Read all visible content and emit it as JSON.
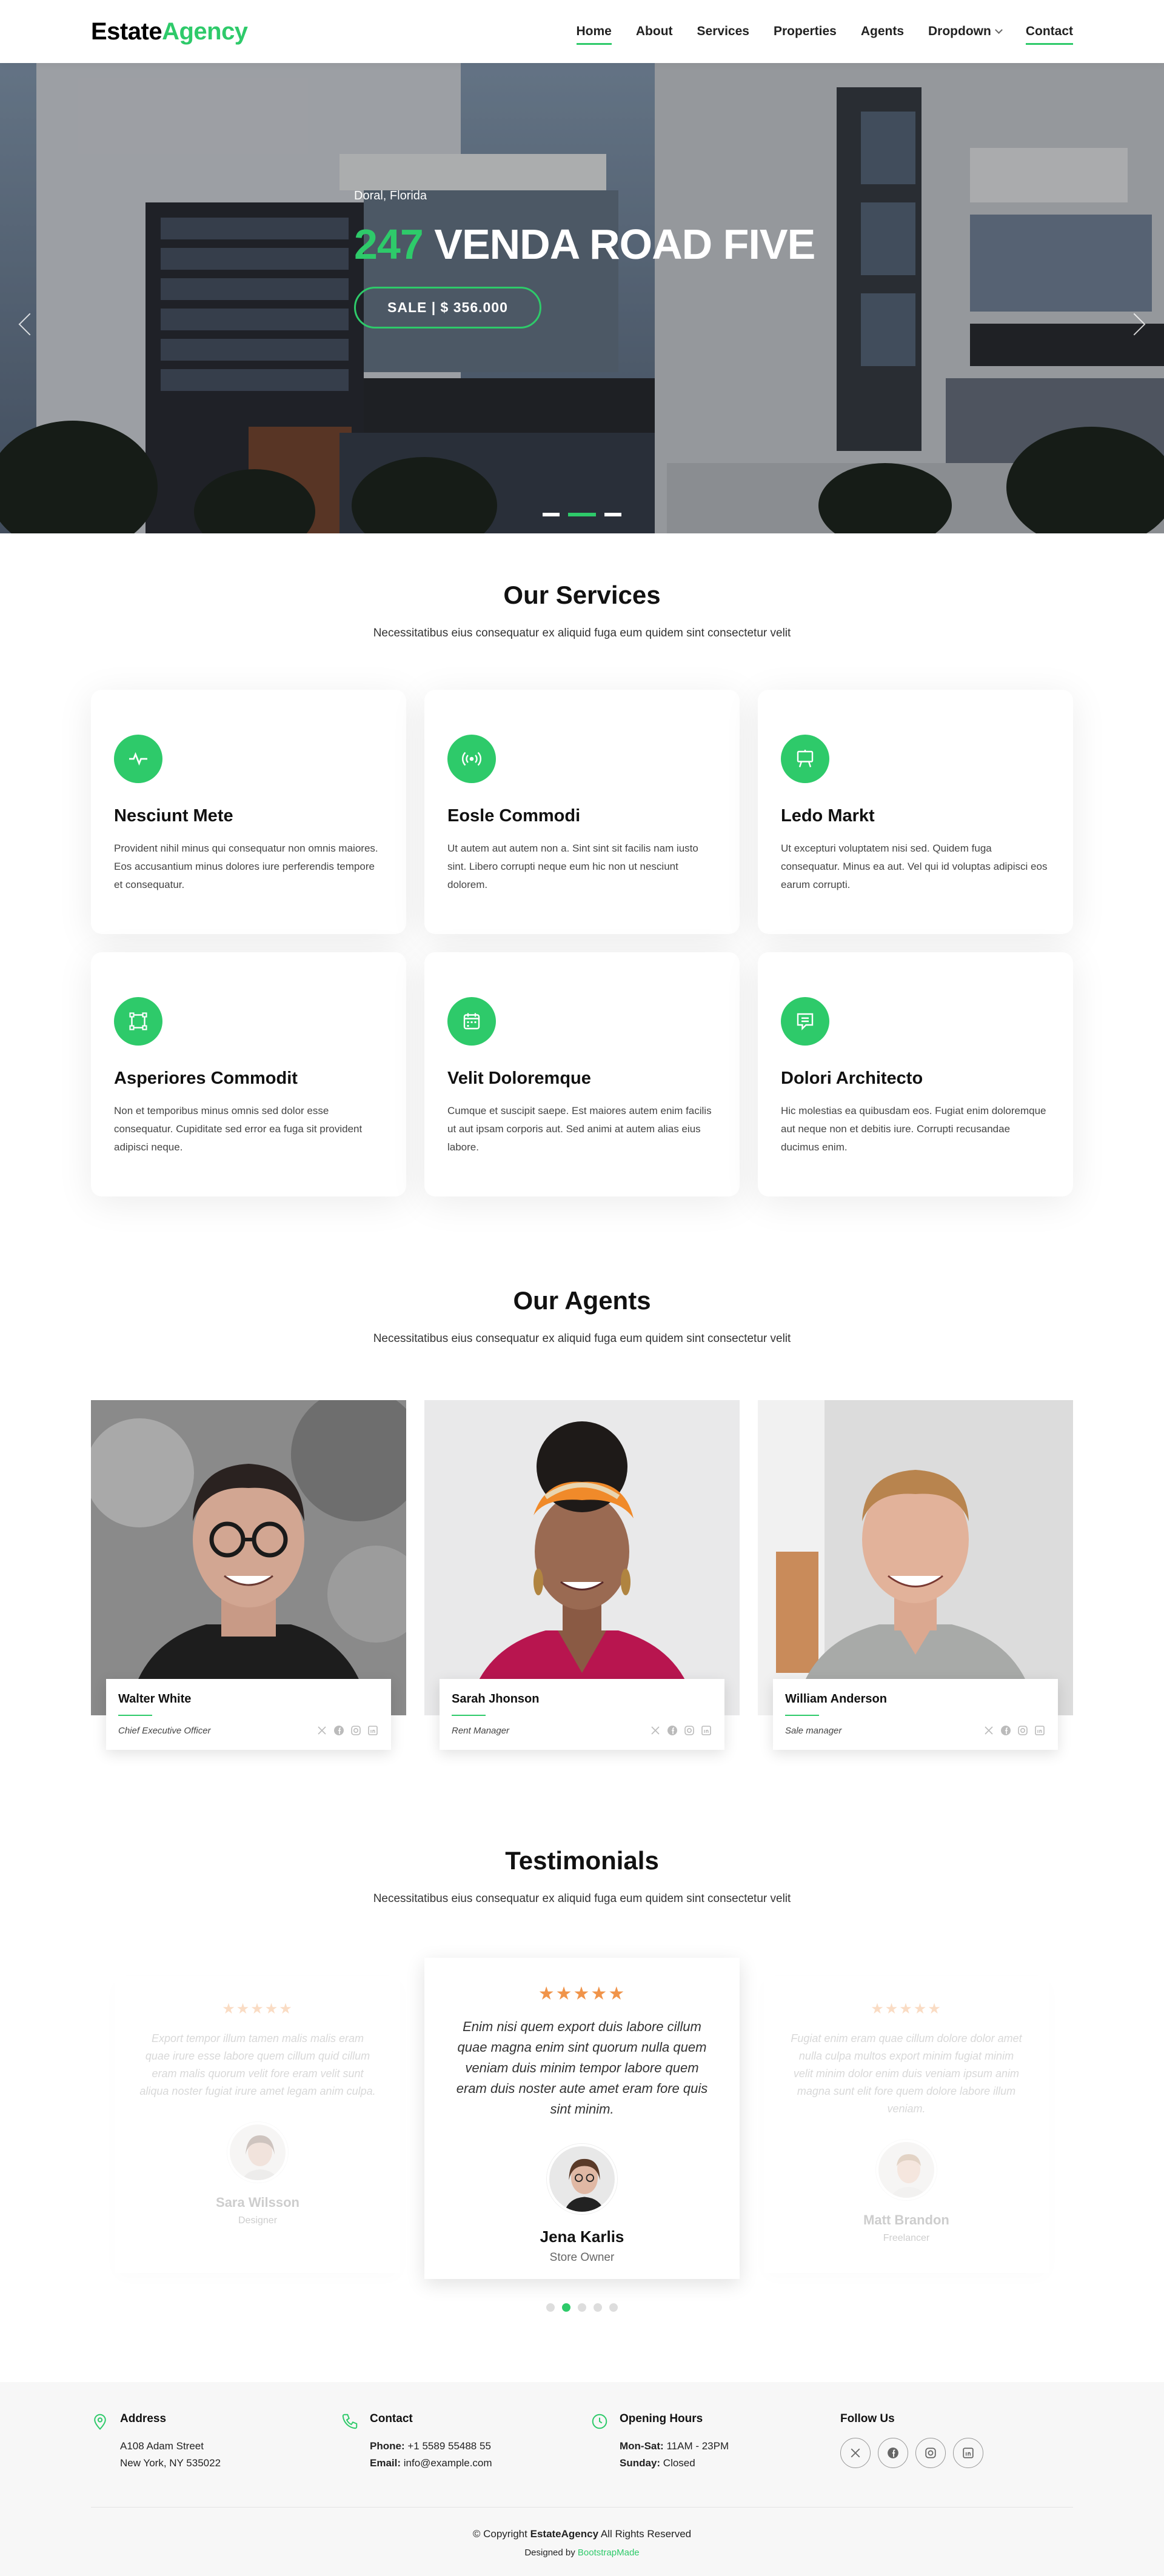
{
  "header": {
    "logo_main": "Estate",
    "logo_accent": "Agency",
    "nav": [
      "Home",
      "About",
      "Services",
      "Properties",
      "Agents",
      "Dropdown",
      "Contact"
    ]
  },
  "hero": {
    "city": "Doral, Florida",
    "number": "247",
    "street": "VENDA ROAD FIVE",
    "button": "SALE | $ 356.000"
  },
  "services": {
    "title": "Our Services",
    "subtitle": "Necessitatibus eius consequatur ex aliquid fuga eum quidem sint consectetur velit",
    "items": [
      {
        "title": "Nesciunt Mete",
        "text": "Provident nihil minus qui consequatur non omnis maiores. Eos accusantium minus dolores iure perferendis tempore et consequatur.",
        "icon": "activity-icon"
      },
      {
        "title": "Eosle Commodi",
        "text": "Ut autem aut autem non a. Sint sint sit facilis nam iusto sint. Libero corrupti neque eum hic non ut nesciunt dolorem.",
        "icon": "broadcast-icon"
      },
      {
        "title": "Ledo Markt",
        "text": "Ut excepturi voluptatem nisi sed. Quidem fuga consequatur. Minus ea aut. Vel qui id voluptas adipisci eos earum corrupti.",
        "icon": "easel-icon"
      },
      {
        "title": "Asperiores Commodit",
        "text": "Non et temporibus minus omnis sed dolor esse consequatur. Cupiditate sed error ea fuga sit provident adipisci neque.",
        "icon": "bounding-box-icon"
      },
      {
        "title": "Velit Doloremque",
        "text": "Cumque et suscipit saepe. Est maiores autem enim facilis ut aut ipsam corporis aut. Sed animi at autem alias eius labore.",
        "icon": "calendar-icon"
      },
      {
        "title": "Dolori Architecto",
        "text": "Hic molestias ea quibusdam eos. Fugiat enim doloremque aut neque non et debitis iure. Corrupti recusandae ducimus enim.",
        "icon": "chat-square-text-icon"
      }
    ]
  },
  "agents": {
    "title": "Our Agents",
    "subtitle": "Necessitatibus eius consequatur ex aliquid fuga eum quidem sint consectetur velit",
    "items": [
      {
        "name": "Walter White",
        "role": "Chief Executive Officer"
      },
      {
        "name": "Sarah Jhonson",
        "role": "Rent Manager"
      },
      {
        "name": "William Anderson",
        "role": "Sale manager"
      }
    ]
  },
  "testimonials": {
    "title": "Testimonials",
    "subtitle": "Necessitatibus eius consequatur ex aliquid fuga eum quidem sint consectetur velit",
    "items": [
      {
        "quote": "Export tempor illum tamen malis malis eram quae irure esse labore quem cillum quid cillum eram malis quorum velit fore eram velit sunt aliqua noster fugiat irure amet legam anim culpa.",
        "name": "Sara Wilsson",
        "role": "Designer",
        "rating": 5
      },
      {
        "quote": "Enim nisi quem export duis labore cillum quae magna enim sint quorum nulla quem veniam duis minim tempor labore quem eram duis noster aute amet eram fore quis sint minim.",
        "name": "Jena Karlis",
        "role": "Store Owner",
        "rating": 5
      },
      {
        "quote": "Fugiat enim eram quae cillum dolore dolor amet nulla culpa multos export minim fugiat minim velit minim dolor enim duis veniam ipsum anim magna sunt elit fore quem dolore labore illum veniam.",
        "name": "Matt Brandon",
        "role": "Freelancer",
        "rating": 5
      }
    ],
    "stars": "★★★★★"
  },
  "footer": {
    "address": {
      "title": "Address",
      "line1": "A108 Adam Street",
      "line2": "New York, NY 535022"
    },
    "contact": {
      "title": "Contact",
      "phone_label": "Phone:",
      "phone": "+1 5589 55488 55",
      "email_label": "Email:",
      "email": "info@example.com"
    },
    "hours": {
      "title": "Opening Hours",
      "l1_label": "Mon-Sat:",
      "l1": "11AM - 23PM",
      "l2_label": "Sunday:",
      "l2": "Closed"
    },
    "follow": {
      "title": "Follow Us"
    },
    "copyright_pre": "© Copyright",
    "copyright_brand": "EstateAgency",
    "copyright_post": "All Rights Reserved",
    "designed_pre": "Designed by",
    "designed_by": "BootstrapMade"
  },
  "colors": {
    "accent": "#2eca6a",
    "star": "#f0944a"
  }
}
